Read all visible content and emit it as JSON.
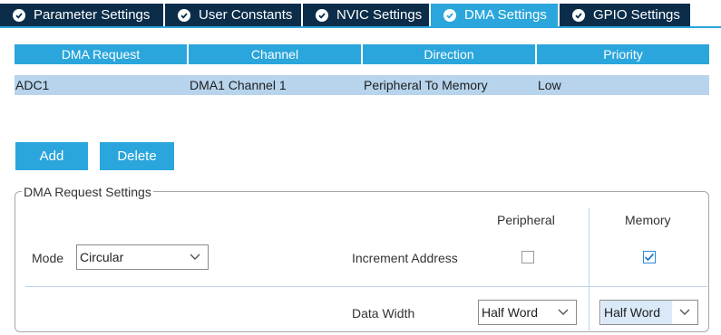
{
  "tabs": [
    {
      "label": "Parameter Settings",
      "active": false
    },
    {
      "label": "User Constants",
      "active": false
    },
    {
      "label": "NVIC Settings",
      "active": false
    },
    {
      "label": "DMA Settings",
      "active": true
    },
    {
      "label": "GPIO Settings",
      "active": false
    }
  ],
  "table": {
    "headers": [
      "DMA Request",
      "Channel",
      "Direction",
      "Priority"
    ],
    "rows": [
      [
        "ADC1",
        "DMA1 Channel 1",
        "Peripheral To Memory",
        "Low"
      ]
    ]
  },
  "buttons": {
    "add": "Add",
    "delete": "Delete"
  },
  "settings": {
    "title": "DMA Request Settings",
    "peripheral_header": "Peripheral",
    "memory_header": "Memory",
    "mode_label": "Mode",
    "mode_value": "Circular",
    "increment_label": "Increment Address",
    "peripheral_increment": false,
    "memory_increment": true,
    "data_width_label": "Data Width",
    "peripheral_width": "Half Word",
    "memory_width": "Half Word"
  },
  "colors": {
    "accent": "#2aa6dc",
    "tab_dark": "#0b2d4a",
    "selected_row": "#b7d4ec"
  },
  "icons": {
    "tab_status": "check-circle-icon",
    "dropdown": "chevron-down-icon",
    "checkbox": "checkmark-icon"
  }
}
